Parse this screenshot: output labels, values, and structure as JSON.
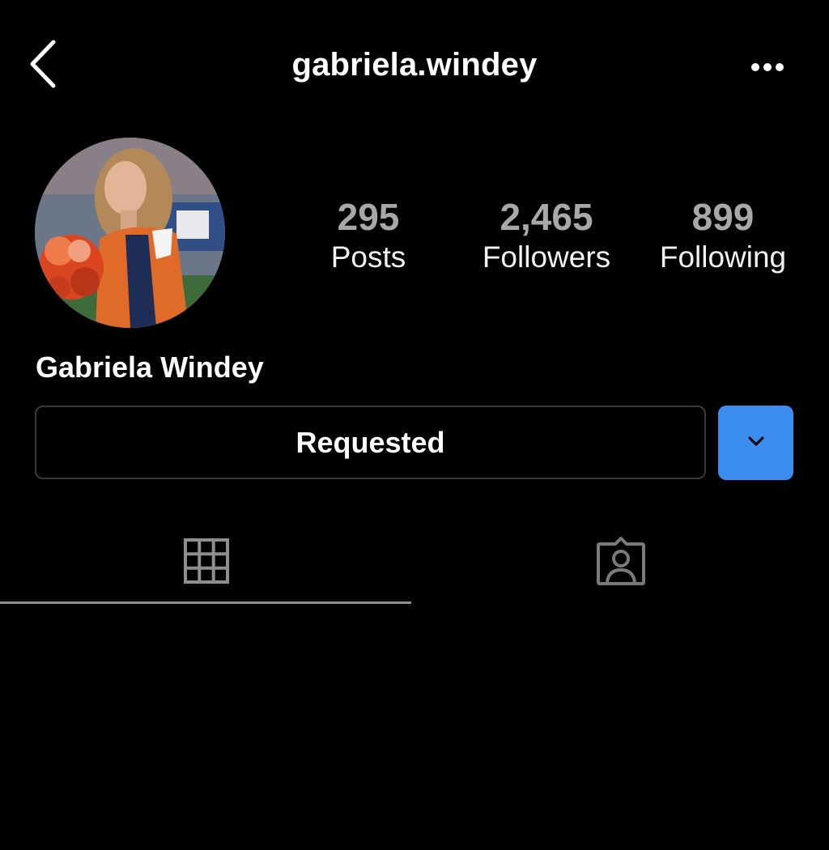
{
  "header": {
    "username": "gabriela.windey",
    "back_icon": "chevron-left-icon",
    "more_icon": "more-horizontal-icon"
  },
  "profile": {
    "display_name": "Gabriela Windey",
    "avatar_description_icon": "profile-avatar"
  },
  "stats": {
    "posts": {
      "value": "295",
      "label": "Posts"
    },
    "followers": {
      "value": "2,465",
      "label": "Followers"
    },
    "following": {
      "value": "899",
      "label": "Following"
    }
  },
  "actions": {
    "requested_label": "Requested",
    "suggest_icon": "chevron-down-icon",
    "accent_color": "#3b8df0"
  },
  "tabs": [
    {
      "name": "grid",
      "icon": "grid-icon",
      "active": true
    },
    {
      "name": "tagged",
      "icon": "tagged-person-icon",
      "active": false
    }
  ],
  "colors": {
    "background": "#000000",
    "text": "#ffffff",
    "muted": "#a8a8a8",
    "border": "#3a3a3a"
  }
}
